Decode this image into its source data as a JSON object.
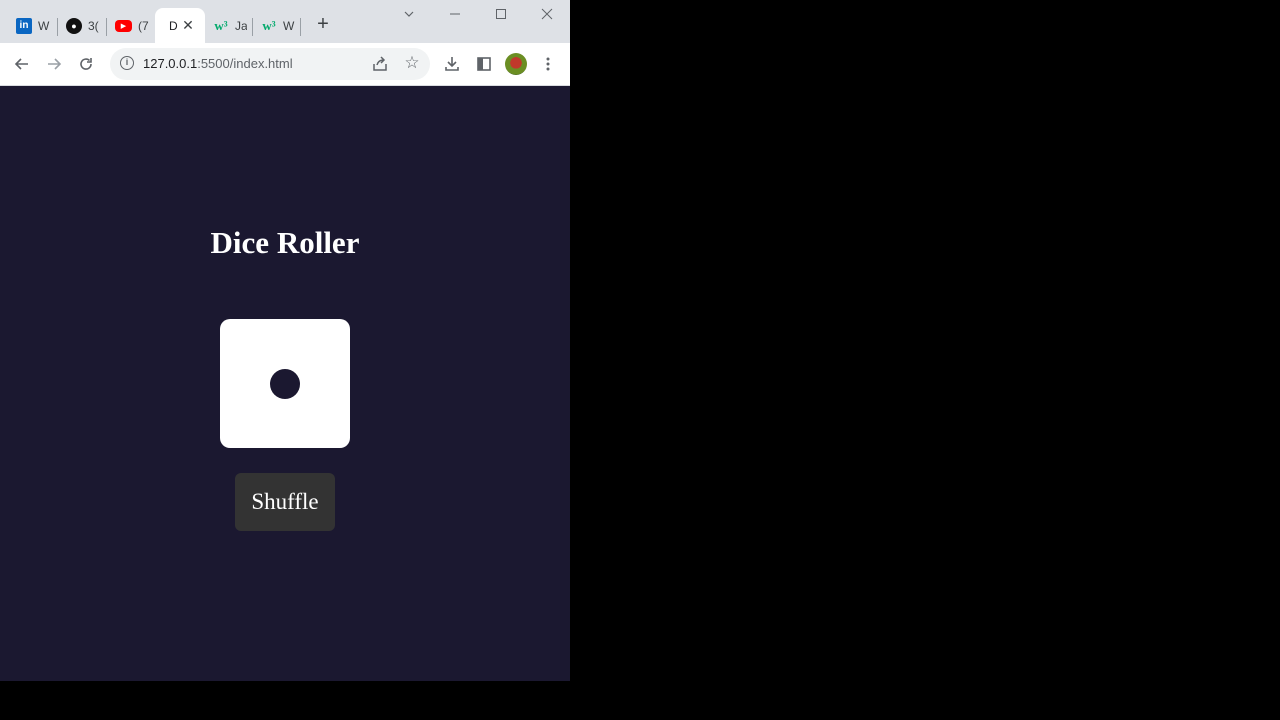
{
  "browser": {
    "tabs": [
      {
        "title": "W",
        "favicon": "linkedin-icon"
      },
      {
        "title": "3(",
        "favicon": "github-icon"
      },
      {
        "title": "(7",
        "favicon": "youtube-icon"
      },
      {
        "title": "D",
        "favicon": "none",
        "active": true
      },
      {
        "title": "Ja",
        "favicon": "w3schools-icon"
      },
      {
        "title": "W",
        "favicon": "w3schools-icon"
      }
    ],
    "new_tab_label": "+",
    "close_tab_label": "✕",
    "url_host": "127.0.0.1",
    "url_rest": ":5500/index.html"
  },
  "page": {
    "title": "Dice Roller",
    "die_value": 1,
    "shuffle_label": "Shuffle"
  },
  "colors": {
    "page_background": "#1b1830",
    "die_face": "#ffffff",
    "pip": "#1b1830",
    "button": "#333333"
  }
}
